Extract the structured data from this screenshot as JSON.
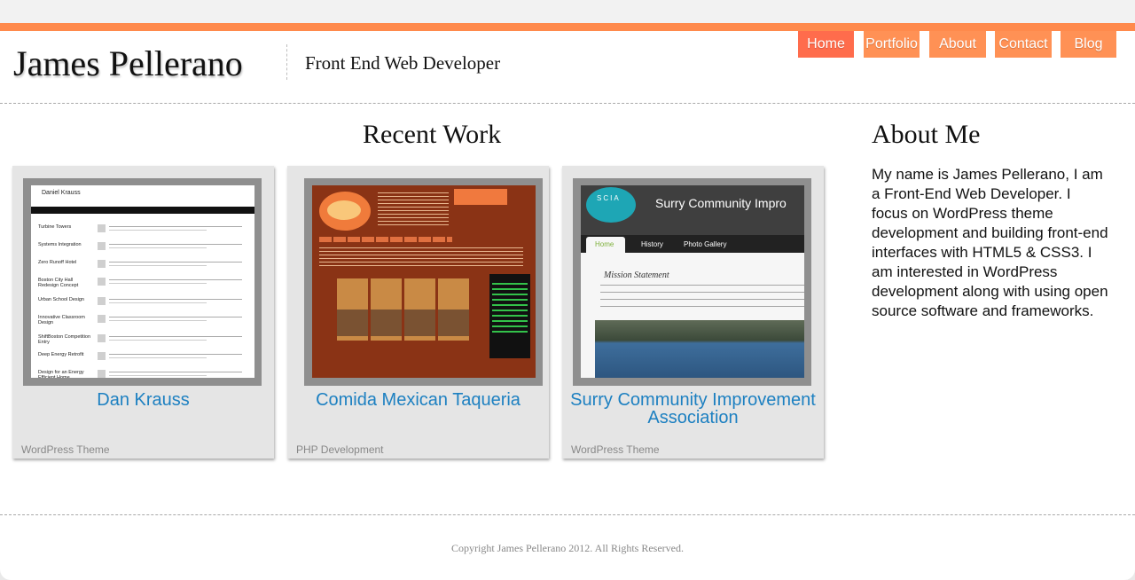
{
  "site": {
    "name": "James Pellerano",
    "tagline": "Front End Web Developer"
  },
  "colors": {
    "accent": "#ff8a4c",
    "nav_active": "#ff6c4c",
    "nav": "#ff9155",
    "link": "#1d80c1"
  },
  "nav": {
    "items": [
      {
        "label": "Home",
        "active": true
      },
      {
        "label": "Portfolio",
        "active": false
      },
      {
        "label": "About",
        "active": false
      },
      {
        "label": "Contact",
        "active": false
      },
      {
        "label": "Blog",
        "active": false
      }
    ]
  },
  "recent_work": {
    "heading": "Recent Work",
    "items": [
      {
        "title": "Dan Krauss",
        "category": "WordPress Theme",
        "thumb": {
          "name": "Daniel Krauss",
          "rows": [
            "Turbine Towers",
            "Systems Integration",
            "Zero Runoff Hotel",
            "Boston City Hall Redesign Concept",
            "Urban School Design",
            "Innovative Classroom Design",
            "ShiftBoston Competition Entry",
            "Deep Energy Retrofit",
            "Design for an Energy Efficient Home"
          ]
        }
      },
      {
        "title": "Comida Mexican Taqueria",
        "category": "PHP Development",
        "thumb": {}
      },
      {
        "title": "Surry Community Improvement Association",
        "category": "WordPress Theme",
        "thumb": {
          "logo": "SCIA",
          "header": "Surry Community Impro",
          "tabs": [
            "Home",
            "History",
            "Photo Gallery"
          ],
          "heading": "Mission Statement"
        }
      }
    ]
  },
  "about": {
    "heading": "About Me",
    "text": "My name is James Pellerano, I am a Front-End Web Developer. I focus on WordPress theme development and building front-end interfaces with HTML5 & CSS3. I am interested in WordPress development along with using open source software and frameworks."
  },
  "footer": {
    "copyright": "Copyright James Pellerano 2012. All Rights Reserved."
  }
}
